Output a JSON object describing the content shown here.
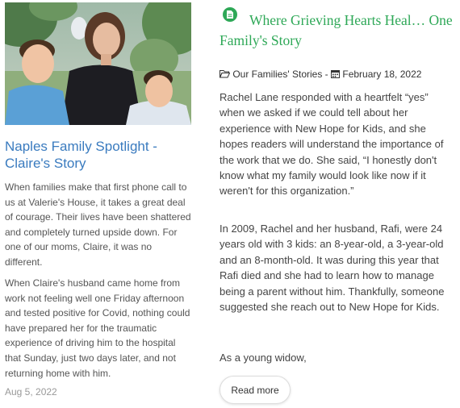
{
  "left_card": {
    "title": "Naples Family Spotlight - Claire's Story",
    "paragraph_1": "When families make that first phone call to us at Valerie's House, it takes a great deal of courage. Their lives have been shattered and completely turned upside down. For one of our moms, Claire, it was no different.",
    "paragraph_2": "When Claire's husband came home from work not feeling well one Friday afternoon and tested positive for Covid, nothing could have prepared her for the traumatic experience of driving him to the hospital that Sunday, just two days later, and not returning home with him.",
    "date": "Aug 5, 2022",
    "photo_icon": "family-photo"
  },
  "right_card": {
    "badge_icon": "document-icon",
    "title": "Where Grieving Hearts Heal… One Family's Story",
    "category": "Our Families' Stories",
    "meta_separator": "-",
    "date": "February 18, 2022",
    "paragraph_1": "Rachel Lane responded with a heartfelt “yes” when we asked if we could tell about her experience with New Hope for Kids, and she hopes readers will understand the importance of the work that we do. She said, “I honestly don't know what my family would look like now if it weren't for this organization.”",
    "paragraph_2": "In 2009, Rachel and her husband, Rafi, were 24 years old with 3 kids: an 8-year-old, a 3-year-old and an 8-month-old. It was during this year that Rafi died and she had to learn how to manage being a parent without him. Thankfully, someone suggested she reach out to New Hope for Kids.",
    "paragraph_3": "As a young widow,",
    "read_more_label": "Read more"
  },
  "colors": {
    "left_title": "#3a7bbf",
    "right_title": "#2ea857",
    "badge": "#2ea857"
  }
}
